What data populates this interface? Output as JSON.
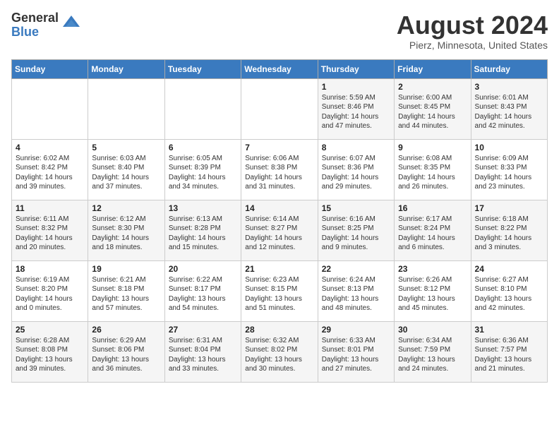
{
  "logo": {
    "general": "General",
    "blue": "Blue"
  },
  "title": {
    "month_year": "August 2024",
    "location": "Pierz, Minnesota, United States"
  },
  "headers": [
    "Sunday",
    "Monday",
    "Tuesday",
    "Wednesday",
    "Thursday",
    "Friday",
    "Saturday"
  ],
  "weeks": [
    [
      {
        "day": "",
        "info": ""
      },
      {
        "day": "",
        "info": ""
      },
      {
        "day": "",
        "info": ""
      },
      {
        "day": "",
        "info": ""
      },
      {
        "day": "1",
        "info": "Sunrise: 5:59 AM\nSunset: 8:46 PM\nDaylight: 14 hours\nand 47 minutes."
      },
      {
        "day": "2",
        "info": "Sunrise: 6:00 AM\nSunset: 8:45 PM\nDaylight: 14 hours\nand 44 minutes."
      },
      {
        "day": "3",
        "info": "Sunrise: 6:01 AM\nSunset: 8:43 PM\nDaylight: 14 hours\nand 42 minutes."
      }
    ],
    [
      {
        "day": "4",
        "info": "Sunrise: 6:02 AM\nSunset: 8:42 PM\nDaylight: 14 hours\nand 39 minutes."
      },
      {
        "day": "5",
        "info": "Sunrise: 6:03 AM\nSunset: 8:40 PM\nDaylight: 14 hours\nand 37 minutes."
      },
      {
        "day": "6",
        "info": "Sunrise: 6:05 AM\nSunset: 8:39 PM\nDaylight: 14 hours\nand 34 minutes."
      },
      {
        "day": "7",
        "info": "Sunrise: 6:06 AM\nSunset: 8:38 PM\nDaylight: 14 hours\nand 31 minutes."
      },
      {
        "day": "8",
        "info": "Sunrise: 6:07 AM\nSunset: 8:36 PM\nDaylight: 14 hours\nand 29 minutes."
      },
      {
        "day": "9",
        "info": "Sunrise: 6:08 AM\nSunset: 8:35 PM\nDaylight: 14 hours\nand 26 minutes."
      },
      {
        "day": "10",
        "info": "Sunrise: 6:09 AM\nSunset: 8:33 PM\nDaylight: 14 hours\nand 23 minutes."
      }
    ],
    [
      {
        "day": "11",
        "info": "Sunrise: 6:11 AM\nSunset: 8:32 PM\nDaylight: 14 hours\nand 20 minutes."
      },
      {
        "day": "12",
        "info": "Sunrise: 6:12 AM\nSunset: 8:30 PM\nDaylight: 14 hours\nand 18 minutes."
      },
      {
        "day": "13",
        "info": "Sunrise: 6:13 AM\nSunset: 8:28 PM\nDaylight: 14 hours\nand 15 minutes."
      },
      {
        "day": "14",
        "info": "Sunrise: 6:14 AM\nSunset: 8:27 PM\nDaylight: 14 hours\nand 12 minutes."
      },
      {
        "day": "15",
        "info": "Sunrise: 6:16 AM\nSunset: 8:25 PM\nDaylight: 14 hours\nand 9 minutes."
      },
      {
        "day": "16",
        "info": "Sunrise: 6:17 AM\nSunset: 8:24 PM\nDaylight: 14 hours\nand 6 minutes."
      },
      {
        "day": "17",
        "info": "Sunrise: 6:18 AM\nSunset: 8:22 PM\nDaylight: 14 hours\nand 3 minutes."
      }
    ],
    [
      {
        "day": "18",
        "info": "Sunrise: 6:19 AM\nSunset: 8:20 PM\nDaylight: 14 hours\nand 0 minutes."
      },
      {
        "day": "19",
        "info": "Sunrise: 6:21 AM\nSunset: 8:18 PM\nDaylight: 13 hours\nand 57 minutes."
      },
      {
        "day": "20",
        "info": "Sunrise: 6:22 AM\nSunset: 8:17 PM\nDaylight: 13 hours\nand 54 minutes."
      },
      {
        "day": "21",
        "info": "Sunrise: 6:23 AM\nSunset: 8:15 PM\nDaylight: 13 hours\nand 51 minutes."
      },
      {
        "day": "22",
        "info": "Sunrise: 6:24 AM\nSunset: 8:13 PM\nDaylight: 13 hours\nand 48 minutes."
      },
      {
        "day": "23",
        "info": "Sunrise: 6:26 AM\nSunset: 8:12 PM\nDaylight: 13 hours\nand 45 minutes."
      },
      {
        "day": "24",
        "info": "Sunrise: 6:27 AM\nSunset: 8:10 PM\nDaylight: 13 hours\nand 42 minutes."
      }
    ],
    [
      {
        "day": "25",
        "info": "Sunrise: 6:28 AM\nSunset: 8:08 PM\nDaylight: 13 hours\nand 39 minutes."
      },
      {
        "day": "26",
        "info": "Sunrise: 6:29 AM\nSunset: 8:06 PM\nDaylight: 13 hours\nand 36 minutes."
      },
      {
        "day": "27",
        "info": "Sunrise: 6:31 AM\nSunset: 8:04 PM\nDaylight: 13 hours\nand 33 minutes."
      },
      {
        "day": "28",
        "info": "Sunrise: 6:32 AM\nSunset: 8:02 PM\nDaylight: 13 hours\nand 30 minutes."
      },
      {
        "day": "29",
        "info": "Sunrise: 6:33 AM\nSunset: 8:01 PM\nDaylight: 13 hours\nand 27 minutes."
      },
      {
        "day": "30",
        "info": "Sunrise: 6:34 AM\nSunset: 7:59 PM\nDaylight: 13 hours\nand 24 minutes."
      },
      {
        "day": "31",
        "info": "Sunrise: 6:36 AM\nSunset: 7:57 PM\nDaylight: 13 hours\nand 21 minutes."
      }
    ]
  ]
}
